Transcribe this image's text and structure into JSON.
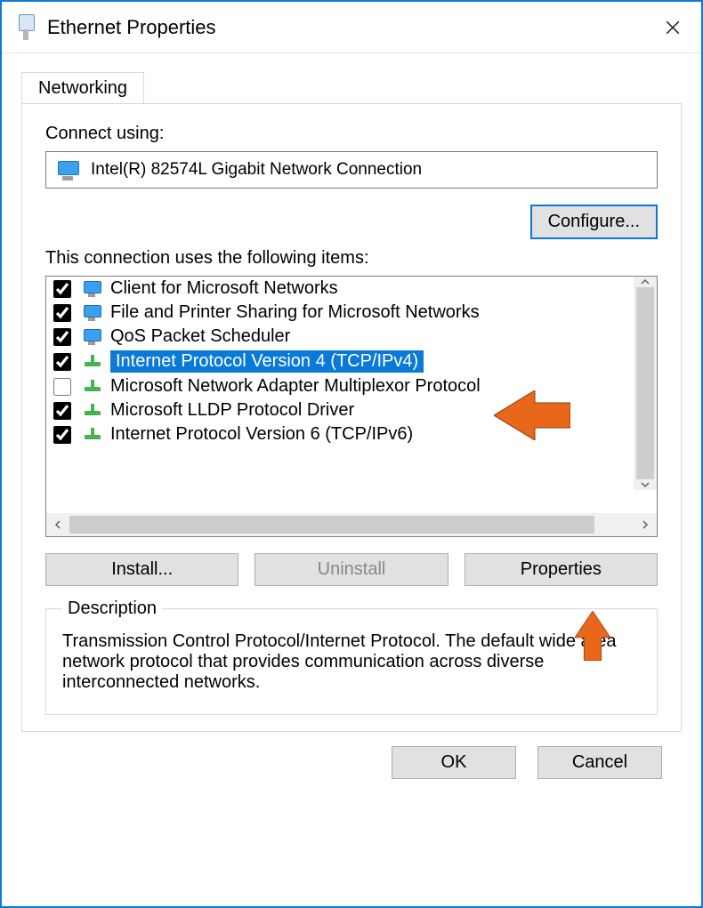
{
  "window": {
    "title": "Ethernet Properties"
  },
  "tab": {
    "label": "Networking"
  },
  "adapter": {
    "label": "Connect using:",
    "name": "Intel(R) 82574L Gigabit Network Connection"
  },
  "buttons": {
    "configure": "Configure...",
    "install": "Install...",
    "uninstall": "Uninstall",
    "properties": "Properties",
    "ok": "OK",
    "cancel": "Cancel"
  },
  "items_label": "This connection uses the following items:",
  "items": [
    {
      "checked": true,
      "icon": "monitor",
      "label": "Client for Microsoft Networks",
      "selected": false
    },
    {
      "checked": true,
      "icon": "monitor",
      "label": "File and Printer Sharing for Microsoft Networks",
      "selected": false
    },
    {
      "checked": true,
      "icon": "monitor",
      "label": "QoS Packet Scheduler",
      "selected": false
    },
    {
      "checked": true,
      "icon": "net",
      "label": "Internet Protocol Version 4 (TCP/IPv4)",
      "selected": true
    },
    {
      "checked": false,
      "icon": "net",
      "label": "Microsoft Network Adapter Multiplexor Protocol",
      "selected": false
    },
    {
      "checked": true,
      "icon": "net",
      "label": "Microsoft LLDP Protocol Driver",
      "selected": false
    },
    {
      "checked": true,
      "icon": "net",
      "label": "Internet Protocol Version 6 (TCP/IPv6)",
      "selected": false
    }
  ],
  "description": {
    "legend": "Description",
    "text": "Transmission Control Protocol/Internet Protocol. The default wide area network protocol that provides communication across diverse interconnected networks."
  }
}
